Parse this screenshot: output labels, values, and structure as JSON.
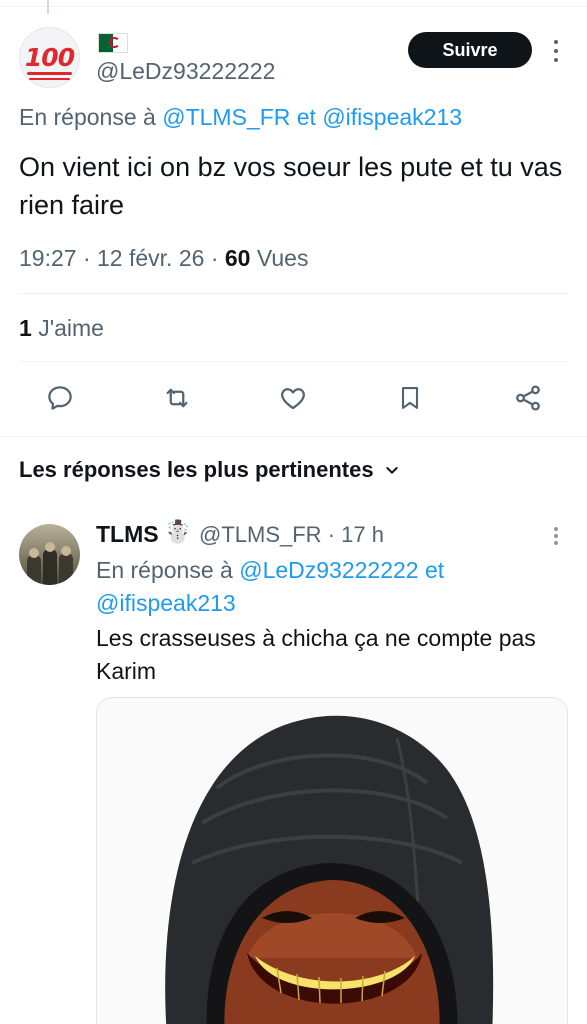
{
  "main_tweet": {
    "avatar_emoji": "100",
    "handle": "@LeDz93222222",
    "follow_label": "Suivre",
    "reply_prefix": "En réponse à",
    "reply_user1": "@TLMS_FR",
    "reply_and": "et",
    "reply_user2": "@ifispeak213",
    "text": "On vient ici on bz vos soeur les pute et tu vas rien faire",
    "time": "19:27",
    "date": "12 févr. 26",
    "sep": "·",
    "views_count": "60",
    "views_label": "Vues",
    "likes_count": "1",
    "likes_label": "J'aime"
  },
  "sort": {
    "label": "Les réponses les plus pertinentes"
  },
  "reply_tweet": {
    "name": "TLMS",
    "name_emoji": "☃️",
    "handle": "@TLMS_FR",
    "sep": "·",
    "age": "17 h",
    "reply_prefix": "En réponse à",
    "reply_user1": "@LeDz93222222",
    "reply_and": "et",
    "reply_user2": "@ifispeak213",
    "text": "Les crasseuses à chicha ça ne compte pas Karim"
  },
  "icons": [
    "reply-icon",
    "retweet-icon",
    "like-icon",
    "bookmark-icon",
    "share-icon",
    "more-icon",
    "chevron-down-icon"
  ],
  "colors": {
    "link": "#1d9bf0",
    "text": "#0f1419",
    "secondary": "#536471",
    "button": "#0f1419"
  }
}
